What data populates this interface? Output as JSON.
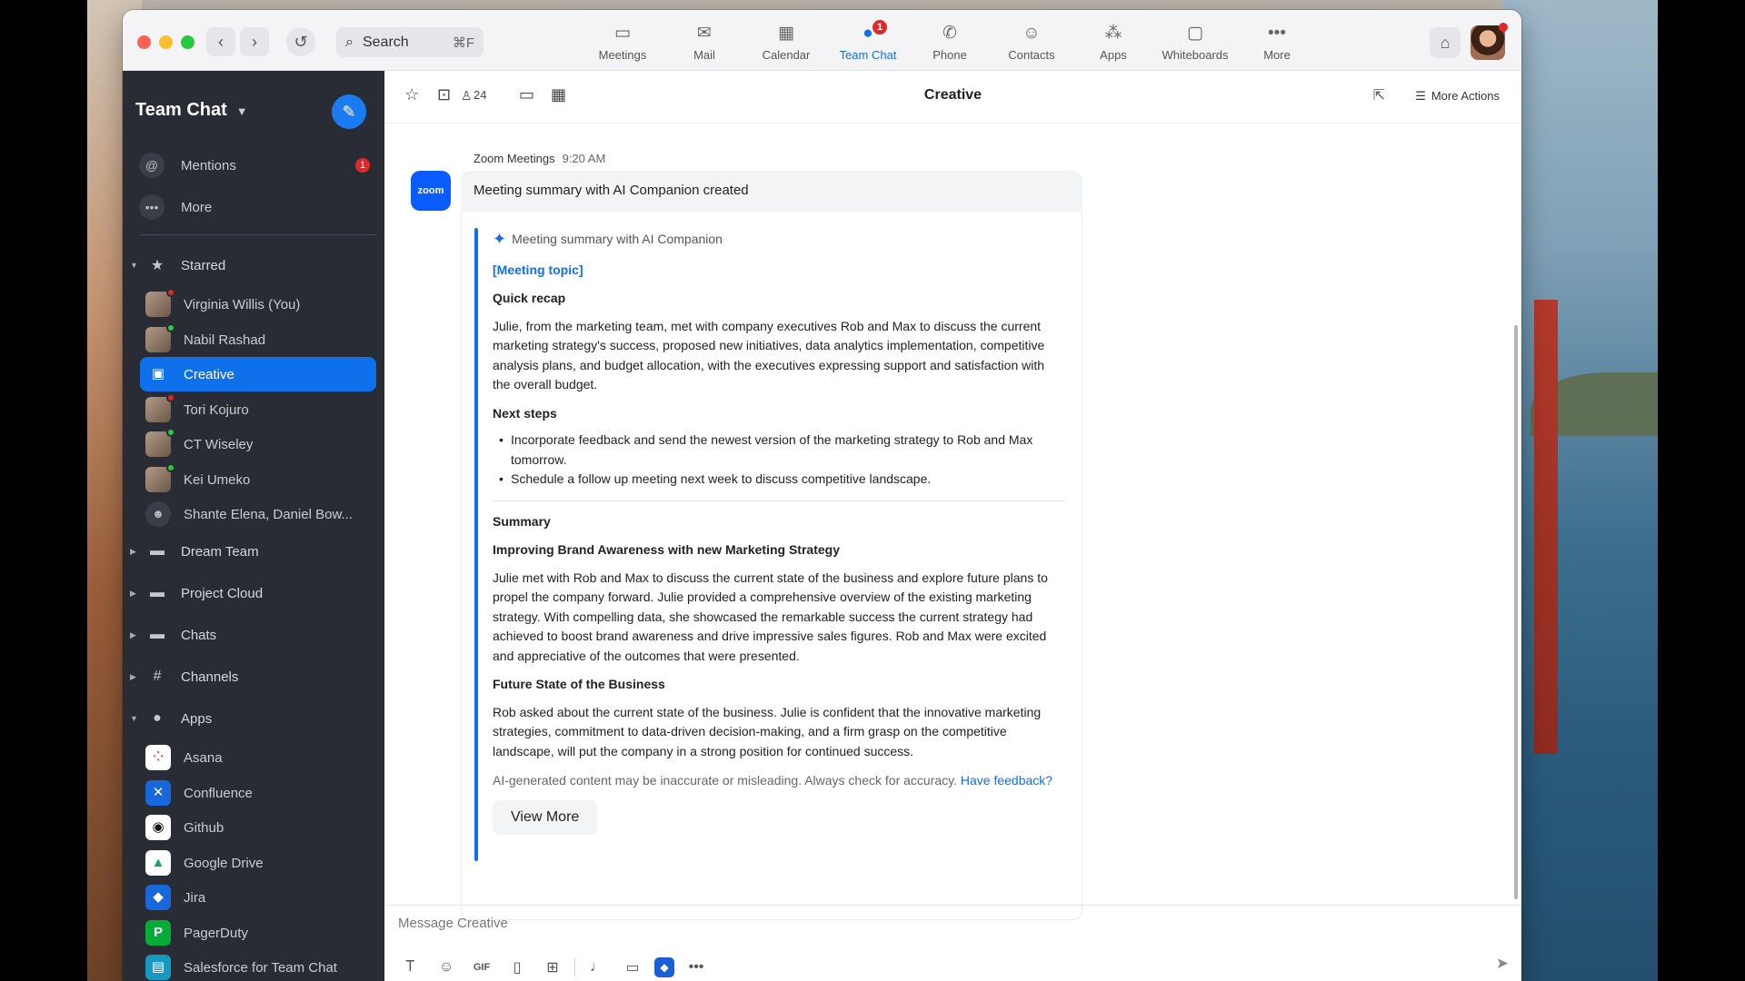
{
  "titlebar": {
    "search_placeholder": "Search",
    "search_shortcut": "⌘F",
    "nav": [
      {
        "label": "Meetings",
        "icon": "video-icon"
      },
      {
        "label": "Mail",
        "icon": "mail-icon"
      },
      {
        "label": "Calendar",
        "icon": "calendar-icon"
      },
      {
        "label": "Team Chat",
        "icon": "chat-icon",
        "badge": "1",
        "active": true
      },
      {
        "label": "Phone",
        "icon": "phone-icon"
      },
      {
        "label": "Contacts",
        "icon": "contacts-icon"
      },
      {
        "label": "Apps",
        "icon": "apps-icon"
      },
      {
        "label": "Whiteboards",
        "icon": "whiteboard-icon"
      },
      {
        "label": "More",
        "icon": "more-icon"
      }
    ]
  },
  "sidebar": {
    "title": "Team Chat",
    "mentions": {
      "label": "Mentions",
      "badge": "1"
    },
    "more": {
      "label": "More"
    },
    "starred": {
      "label": "Starred",
      "items": [
        {
          "label": "Virginia Willis (You)",
          "status": "busy"
        },
        {
          "label": "Nabil Rashad",
          "status": "online"
        },
        {
          "label": "Creative",
          "selected": true
        },
        {
          "label": "Tori Kojuro",
          "status": "busy"
        },
        {
          "label": "CT Wiseley",
          "status": "online"
        },
        {
          "label": "Kei Umeko",
          "status": "online"
        },
        {
          "label": "Shante Elena, Daniel Bow..."
        }
      ]
    },
    "groups": {
      "dream_team": "Dream Team",
      "project_cloud": "Project Cloud",
      "chats": "Chats",
      "channels": "Channels",
      "apps": "Apps"
    },
    "apps": [
      {
        "label": "Asana",
        "color": "#ffffff"
      },
      {
        "label": "Confluence",
        "color": "#1868db"
      },
      {
        "label": "Github",
        "color": "#ffffff"
      },
      {
        "label": "Google Drive",
        "color": "#ffffff"
      },
      {
        "label": "Jira",
        "color": "#1868db"
      },
      {
        "label": "PagerDuty",
        "color": "#06ac38"
      },
      {
        "label": "Salesforce for Team Chat",
        "color": "#1798c1"
      }
    ]
  },
  "channel": {
    "member_count": "24",
    "title": "Creative",
    "more_actions": "More Actions"
  },
  "message": {
    "sender": "Zoom Meetings",
    "time": "9:20 AM",
    "avatar_text": "zoom",
    "text": "Meeting summary with AI Companion created",
    "card": {
      "header": "Meeting summary with AI Companion",
      "topic": "[Meeting topic]",
      "quick_recap_title": "Quick recap",
      "quick_recap": "Julie, from the marketing team, met with company executives Rob and Max to discuss the current marketing strategy's success, proposed new initiatives, data analytics implementation, competitive analysis plans, and budget allocation, with the executives expressing support and satisfaction with the overall budget.",
      "next_steps_title": "Next steps",
      "next_steps": [
        "Incorporate feedback and send the newest version of the marketing strategy to Rob and Max tomorrow.",
        "Schedule a follow up meeting next week to discuss competitive landscape."
      ],
      "summary_title": "Summary",
      "summary_sub1": "Improving Brand Awareness with new Marketing Strategy",
      "summary_para1": "Julie met with Rob and Max to discuss the current state of the business and explore future plans to propel the company forward. Julie provided a comprehensive overview of the existing marketing strategy. With compelling data, she showcased the remarkable success the current strategy had achieved to boost brand awareness and drive impressive sales figures. Rob and Max were excited and appreciative of the outcomes that were presented.",
      "summary_sub2": "Future State of the Business",
      "summary_para2": "Rob asked about the current state of the business. Julie is confident that the innovative marketing strategies, commitment to data-driven decision-making, and a firm grasp on the competitive landscape, will put the company in a strong position for continued success.",
      "disclaimer": "AI-generated content may be inaccurate or misleading. Always check for accuracy.",
      "feedback_link": "Have feedback?",
      "view_more": "View More"
    }
  },
  "composer": {
    "placeholder": "Message Creative",
    "gif_label": "GIF"
  },
  "colors": {
    "accent": "#0e71eb",
    "sidebar_bg": "#292c35",
    "badge": "#e02828",
    "online": "#28c840"
  }
}
